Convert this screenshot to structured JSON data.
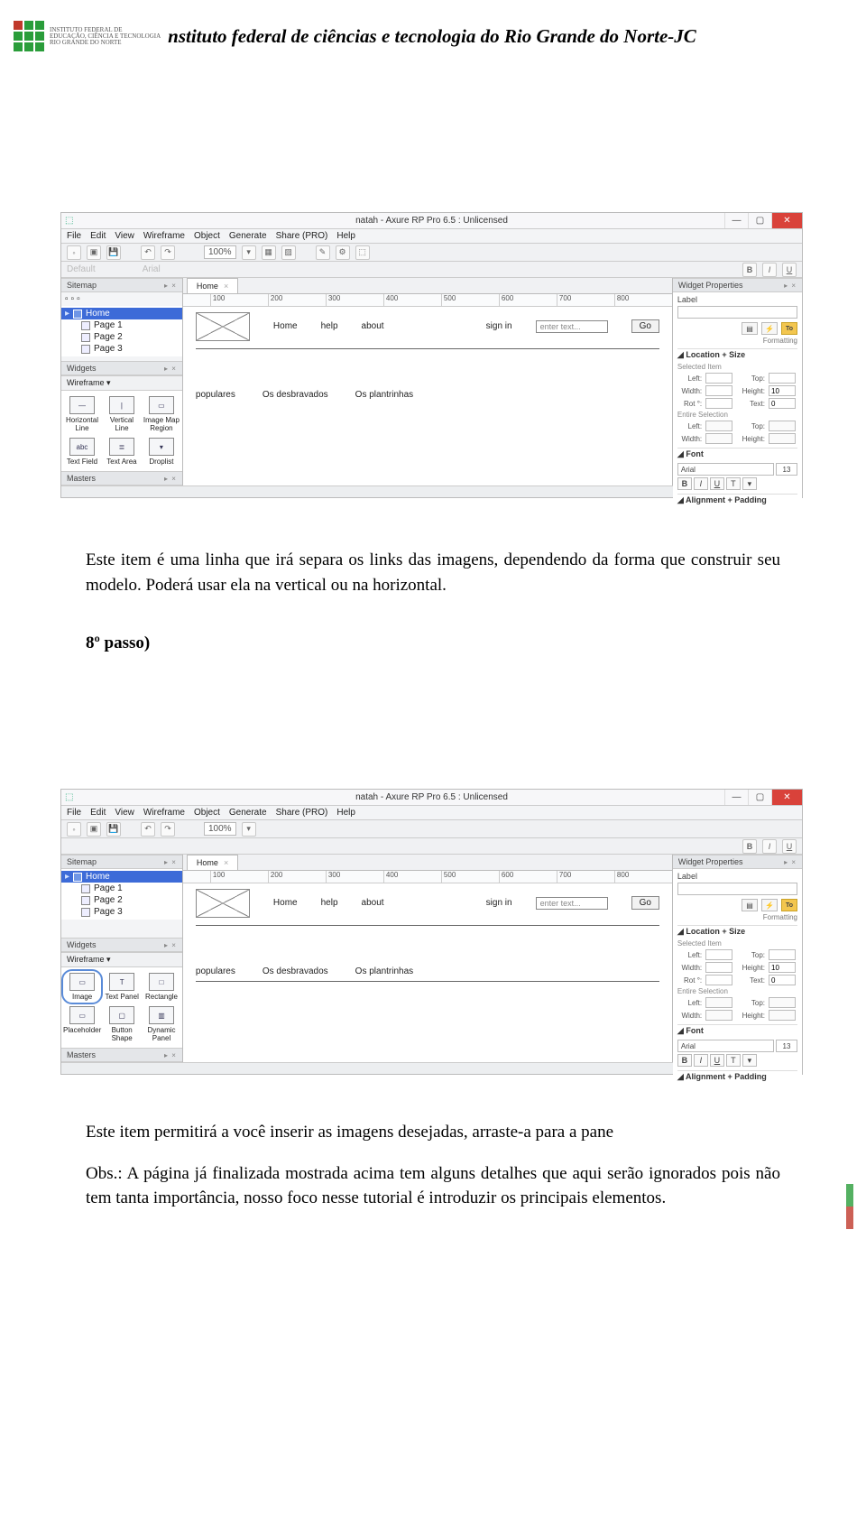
{
  "header": {
    "logo_text_lines": [
      "INSTITUTO FEDERAL DE",
      "EDUCAÇÃO, CIÊNCIA E TECNOLOGIA",
      "RIO GRANDE DO NORTE"
    ],
    "title": "nstituto federal de ciências e tecnologia do Rio Grande do Norte-JC"
  },
  "paragraphs": {
    "p1": "Este item é uma linha que irá separa os links das imagens, dependendo da forma que construir seu modelo. Poderá usar ela na vertical ou na horizontal.",
    "step": "8º passo)",
    "p2": "Este item permitirá a você inserir as imagens desejadas, arraste-a para a pane",
    "p3": "Obs.: A página já finalizada mostrada acima tem alguns detalhes que aqui serão ignorados pois não tem tanta importância, nosso foco nesse tutorial é introduzir os principais elementos."
  },
  "axure": {
    "title": "natah - Axure RP Pro 6.5 : Unlicensed",
    "menu": [
      "File",
      "Edit",
      "View",
      "Wireframe",
      "Object",
      "Generate",
      "Share (PRO)",
      "Help"
    ],
    "zoom": "100%",
    "tab": "Home",
    "ruler": [
      "100",
      "200",
      "300",
      "400",
      "500",
      "600",
      "700",
      "800"
    ],
    "sitemap_title": "Sitemap",
    "sitemap_home": "Home",
    "sitemap_pages": [
      "Page 1",
      "Page 2",
      "Page 3"
    ],
    "widgets_title": "Widgets",
    "wireframe_label": "Wireframe ▾",
    "masters_title": "Masters",
    "canvas_nav": [
      "Home",
      "help",
      "about"
    ],
    "canvas_signin": "sign in",
    "canvas_placeholder": "enter text...",
    "canvas_go": "Go",
    "canvas_sections": [
      "populares",
      "Os desbravados",
      "Os plantrinhas"
    ],
    "wp_title": "Widget Properties",
    "wp_label": "Label",
    "wp_formatting": "Formatting",
    "wp_to": "To",
    "wp_locsize": "Location + Size",
    "wp_selected": "Selected Item",
    "wp_left": "Left:",
    "wp_top": "Top:",
    "wp_width": "Width:",
    "wp_height": "Height:",
    "wp_height_v": "10",
    "wp_rot": "Rot °:",
    "wp_text": "Text:",
    "wp_text_v": "0",
    "wp_entire": "Entire Selection",
    "wp_font": "Font",
    "wp_font_name": "Arial",
    "wp_font_size": "13",
    "wp_alignpad": "Alignment + Padding"
  },
  "axure1_widgets": [
    {
      "label": "Horizontal Line",
      "glyph": "—"
    },
    {
      "label": "Vertical Line",
      "glyph": "|"
    },
    {
      "label": "Image Map Region",
      "glyph": "▭"
    },
    {
      "label": "Text Field",
      "glyph": "abc"
    },
    {
      "label": "Text Area",
      "glyph": "≣"
    },
    {
      "label": "Droplist",
      "glyph": "▾"
    }
  ],
  "axure2_widgets": [
    {
      "label": "Image",
      "glyph": "▭"
    },
    {
      "label": "Text Panel",
      "glyph": "T"
    },
    {
      "label": "Rectangle",
      "glyph": "□"
    },
    {
      "label": "Placeholder",
      "glyph": "▭"
    },
    {
      "label": "Button Shape",
      "glyph": "▢"
    },
    {
      "label": "Dynamic Panel",
      "glyph": "▥"
    }
  ]
}
